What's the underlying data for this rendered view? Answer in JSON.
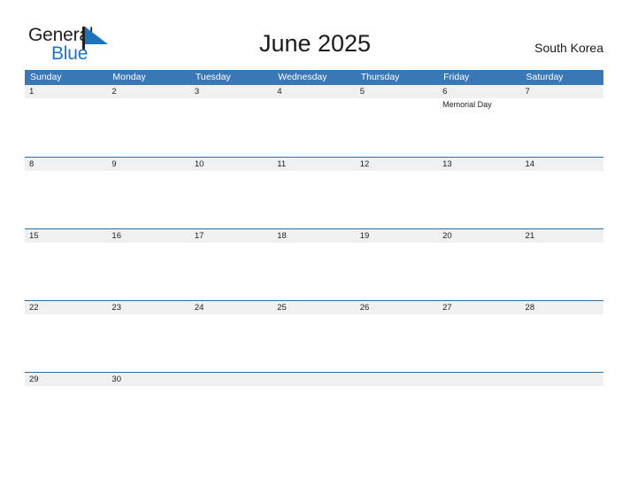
{
  "brand": {
    "name_part1": "General",
    "name_part2": "Blue",
    "flag_icon": "flag-triangle-icon",
    "color_blue": "#1d74bd",
    "color_dark": "#231f20"
  },
  "header": {
    "title": "June 2025",
    "country": "South Korea"
  },
  "calendar": {
    "accent_color": "#3a77b5",
    "band_color": "#f0f0f0",
    "rule_color": "#2e6da4",
    "weekdays": [
      "Sunday",
      "Monday",
      "Tuesday",
      "Wednesday",
      "Thursday",
      "Friday",
      "Saturday"
    ],
    "weeks": [
      [
        {
          "day": "1",
          "events": []
        },
        {
          "day": "2",
          "events": []
        },
        {
          "day": "3",
          "events": []
        },
        {
          "day": "4",
          "events": []
        },
        {
          "day": "5",
          "events": []
        },
        {
          "day": "6",
          "events": [
            "Memorial Day"
          ]
        },
        {
          "day": "7",
          "events": []
        }
      ],
      [
        {
          "day": "8",
          "events": []
        },
        {
          "day": "9",
          "events": []
        },
        {
          "day": "10",
          "events": []
        },
        {
          "day": "11",
          "events": []
        },
        {
          "day": "12",
          "events": []
        },
        {
          "day": "13",
          "events": []
        },
        {
          "day": "14",
          "events": []
        }
      ],
      [
        {
          "day": "15",
          "events": []
        },
        {
          "day": "16",
          "events": []
        },
        {
          "day": "17",
          "events": []
        },
        {
          "day": "18",
          "events": []
        },
        {
          "day": "19",
          "events": []
        },
        {
          "day": "20",
          "events": []
        },
        {
          "day": "21",
          "events": []
        }
      ],
      [
        {
          "day": "22",
          "events": []
        },
        {
          "day": "23",
          "events": []
        },
        {
          "day": "24",
          "events": []
        },
        {
          "day": "25",
          "events": []
        },
        {
          "day": "26",
          "events": []
        },
        {
          "day": "27",
          "events": []
        },
        {
          "day": "28",
          "events": []
        }
      ],
      [
        {
          "day": "29",
          "events": []
        },
        {
          "day": "30",
          "events": []
        },
        {
          "day": "",
          "events": []
        },
        {
          "day": "",
          "events": []
        },
        {
          "day": "",
          "events": []
        },
        {
          "day": "",
          "events": []
        },
        {
          "day": "",
          "events": []
        }
      ]
    ]
  }
}
